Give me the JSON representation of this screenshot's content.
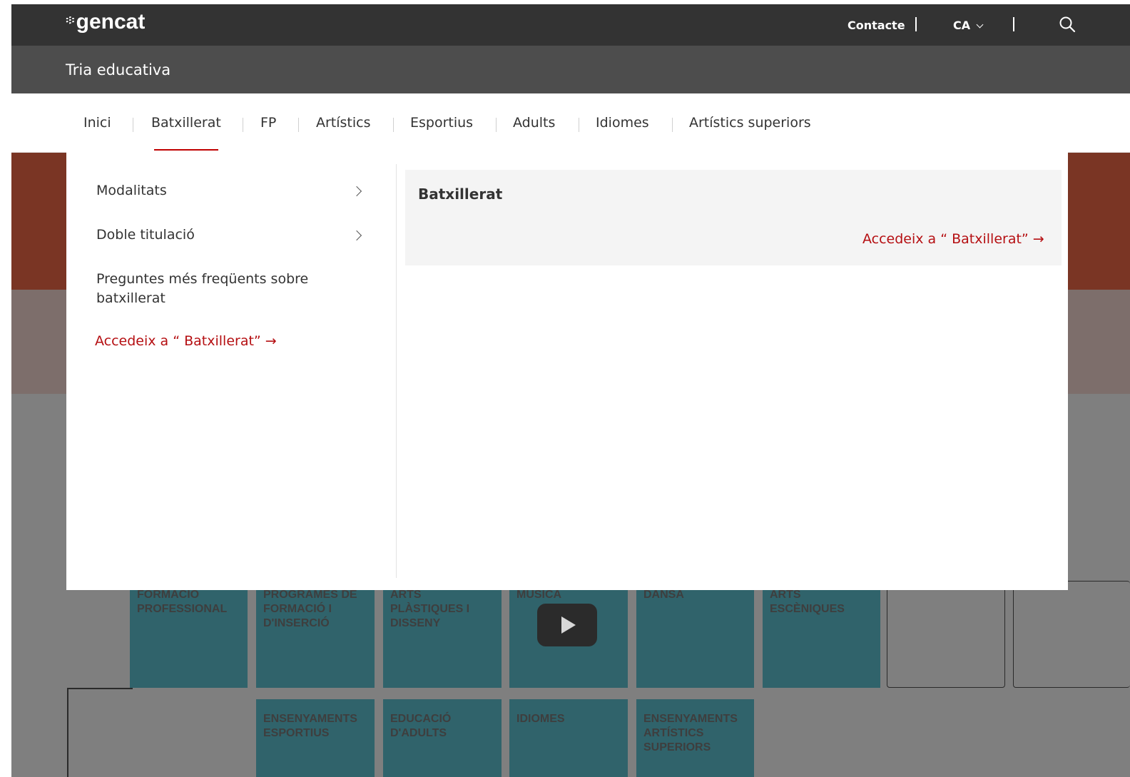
{
  "brand": {
    "dots": "፨",
    "name": "gencat"
  },
  "topbar": {
    "contact_label": "Contacte",
    "lang_label": "CA"
  },
  "subheader": {
    "title": "Tria educativa"
  },
  "nav": {
    "items": [
      "Inici",
      "Batxillerat",
      "FP",
      "Artístics",
      "Esportius",
      "Adults",
      "Idiomes",
      "Artístics superiors"
    ],
    "active": "Batxillerat"
  },
  "mega_menu": {
    "left_items": [
      "Modalitats",
      "Doble titulació",
      "Preguntes més freqüents sobre batxillerat"
    ],
    "access_link": "Accedeix a “ Batxillerat” →",
    "card": {
      "title": "Batxillerat",
      "link": "Accedeix a “ Batxillerat” →"
    }
  },
  "background_tiles": {
    "row1": [
      "FORMACIÓ PROFESSIONAL",
      "PROGRAMES DE FORMACIÓ I D'INSERCIÓ",
      "ARTS PLÀSTIQUES I DISSENY",
      "MÚSICA",
      "DANSA",
      "ARTS ESCÈNIQUES"
    ],
    "row2": [
      "ENSENYAMENTS ESPORTIUS",
      "EDUCACIÓ D'ADULTS",
      "IDIOMES",
      "ENSENYAMENTS ARTÍSTICS SUPERIORS"
    ]
  },
  "colors": {
    "accent": "#b50f12",
    "topbar": "#333333",
    "subheader": "#4d4d4d",
    "tile": "#30636b"
  }
}
